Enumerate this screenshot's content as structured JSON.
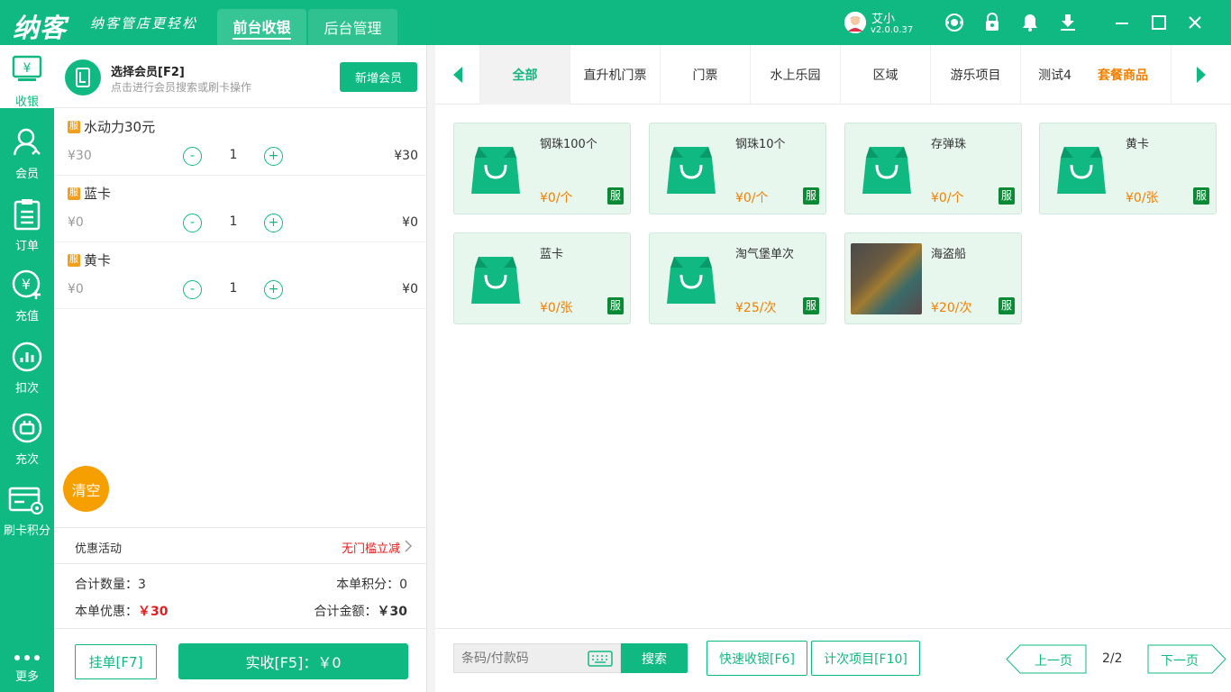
{
  "app": {
    "logo": "纳客",
    "slogan": "纳客管店更轻松",
    "tabs": [
      "前台收银",
      "后台管理"
    ],
    "user_name": "艾小",
    "version": "v2.0.0.37"
  },
  "sidebar": {
    "items": [
      {
        "label": "收银",
        "icon": "cashier-icon"
      },
      {
        "label": "会员",
        "icon": "member-icon"
      },
      {
        "label": "订单",
        "icon": "order-icon"
      },
      {
        "label": "充值",
        "icon": "recharge-icon"
      },
      {
        "label": "扣次",
        "icon": "deduct-icon"
      },
      {
        "label": "充次",
        "icon": "recharge-count-icon"
      },
      {
        "label": "刷卡积分",
        "icon": "card-points-icon"
      },
      {
        "label": "更多",
        "icon": "more-icon"
      }
    ]
  },
  "member": {
    "title": "选择会员[F2]",
    "subtitle": "点击进行会员搜索或刷卡操作",
    "add_button": "新增会员"
  },
  "cart": {
    "items": [
      {
        "tag": "服",
        "name": "水动力30元",
        "price": "¥30",
        "qty": "1",
        "total": "¥30"
      },
      {
        "tag": "服",
        "name": "蓝卡",
        "price": "¥0",
        "qty": "1",
        "total": "¥0"
      },
      {
        "tag": "服",
        "name": "黄卡",
        "price": "¥0",
        "qty": "1",
        "total": "¥0"
      }
    ],
    "minus": "-",
    "plus": "+",
    "clear_button": "清空"
  },
  "promo": {
    "label": "优惠活动",
    "value": "无门槛立减"
  },
  "summary": {
    "count_label": "合计数量：",
    "count": "3",
    "points_label": "本单积分：",
    "points": "0",
    "discount_label": "本单优惠：",
    "discount": "￥30",
    "amount_label": "合计金额：",
    "amount": "￥30"
  },
  "footer": {
    "hold_button": "挂单[F7]",
    "pay_button": "实收[F5]：￥0"
  },
  "categories": {
    "items": [
      "全部",
      "直升机门票",
      "门票",
      "水上乐园",
      "区域",
      "游乐项目",
      "测试4"
    ],
    "extra": "套餐商品",
    "active": "全部"
  },
  "products": [
    {
      "name": "钢珠100个",
      "price": "¥0/个",
      "tag": "服"
    },
    {
      "name": "钢珠10个",
      "price": "¥0/个",
      "tag": "服"
    },
    {
      "name": "存弹珠",
      "price": "¥0/个",
      "tag": "服"
    },
    {
      "name": "黄卡",
      "price": "¥0/张",
      "tag": "服"
    },
    {
      "name": "蓝卡",
      "price": "¥0/张",
      "tag": "服"
    },
    {
      "name": "淘气堡单次",
      "price": "¥25/次",
      "tag": "服"
    },
    {
      "name": "海盗船",
      "price": "¥20/次",
      "tag": "服"
    }
  ],
  "bottom": {
    "search_placeholder": "条码/付款码",
    "search_button": "搜索",
    "quick_button": "快速收银[F6]",
    "count_button": "计次项目[F10]",
    "prev_button": "上一页",
    "page": "2/2",
    "next_button": "下一页"
  },
  "colors": {
    "primary": "#10b982",
    "orange": "#f5a000",
    "price": "#f08000",
    "red": "#e02020"
  }
}
